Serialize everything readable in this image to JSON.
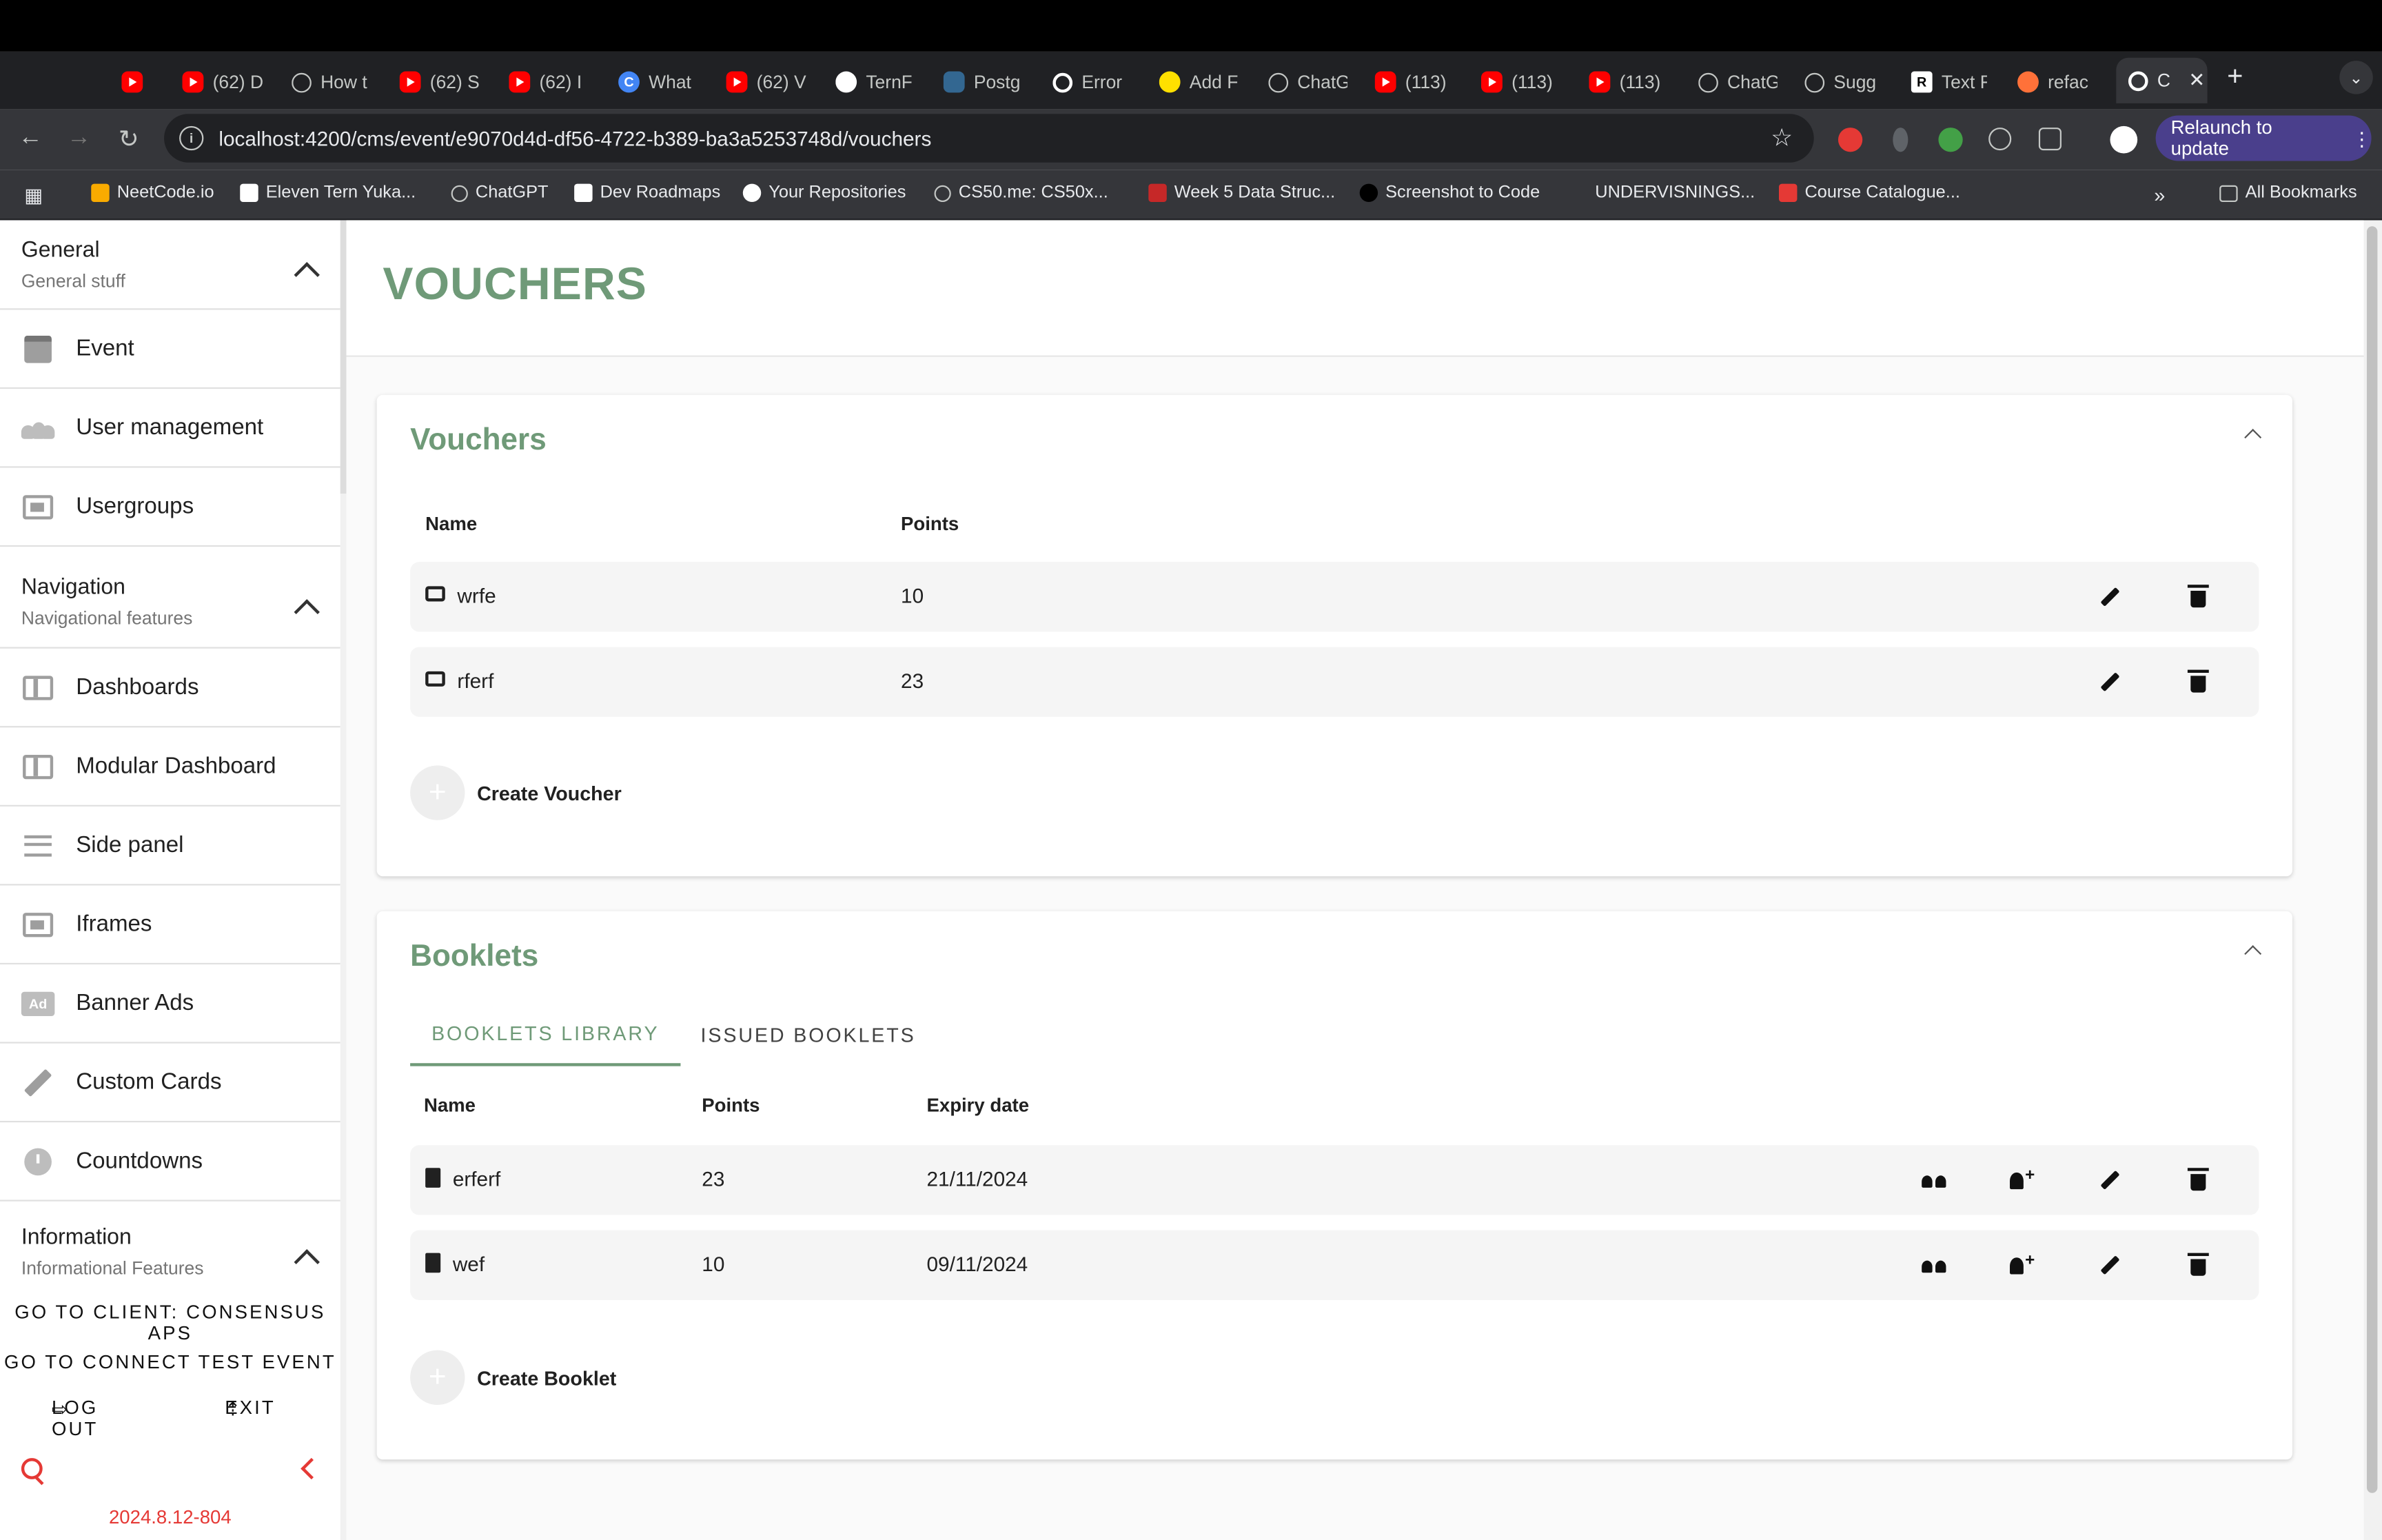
{
  "browser": {
    "tabs": [
      {
        "icon": "youtube-icon",
        "label": ""
      },
      {
        "icon": "youtube-icon",
        "label": "(62) D"
      },
      {
        "icon": "globe-icon",
        "label": "How t"
      },
      {
        "icon": "youtube-icon",
        "label": "(62) S"
      },
      {
        "icon": "youtube-icon",
        "label": "(62) I"
      },
      {
        "icon": "c-icon",
        "label": "What"
      },
      {
        "icon": "youtube-icon",
        "label": "(62) V"
      },
      {
        "icon": "github-icon",
        "label": "TernF"
      },
      {
        "icon": "postgres-icon",
        "label": "Postg"
      },
      {
        "icon": "circle-icon",
        "label": "Error"
      },
      {
        "icon": "add-icon",
        "label": "Add F"
      },
      {
        "icon": "chatgpt-icon",
        "label": "ChatG"
      },
      {
        "icon": "youtube-icon",
        "label": "(113)"
      },
      {
        "icon": "youtube-icon",
        "label": "(113)"
      },
      {
        "icon": "youtube-icon",
        "label": "(113)"
      },
      {
        "icon": "chatgpt-icon",
        "label": "ChatG"
      },
      {
        "icon": "chatgpt-icon",
        "label": "Sugg"
      },
      {
        "icon": "r-icon",
        "label": "Text F"
      },
      {
        "icon": "fox-icon",
        "label": "refac"
      }
    ],
    "active_tab_label": "C",
    "url": "localhost:4200/cms/event/e9070d4d-df56-4722-b389-ba3a5253748d/vouchers",
    "relaunch_label": "Relaunch to update",
    "bookmarks": [
      "NeetCode.io",
      "Eleven Tern Yuka...",
      "ChatGPT",
      "Dev Roadmaps",
      "Your Repositories",
      "CS50.me: CS50x...",
      "Week 5 Data Struc...",
      "Screenshot to Code",
      "UNDERVISNINGS...",
      "Course Catalogue..."
    ],
    "all_bookmarks_label": "All Bookmarks"
  },
  "sidebar": {
    "general": {
      "title": "General",
      "subtitle": "General stuff"
    },
    "general_items": [
      "Event",
      "User management",
      "Usergroups"
    ],
    "navigation": {
      "title": "Navigation",
      "subtitle": "Navigational features"
    },
    "navigation_items": [
      "Dashboards",
      "Modular Dashboard",
      "Side panel",
      "Iframes",
      "Banner Ads",
      "Custom Cards",
      "Countdowns"
    ],
    "information": {
      "title": "Information",
      "subtitle": "Informational Features"
    },
    "goto_client": "GO TO CLIENT: CONSENSUS APS",
    "goto_event": "GO TO CONNECT TEST EVENT",
    "logout": "LOG OUT",
    "exit": "EXIT",
    "version": "2024.8.12-804"
  },
  "page": {
    "title": "VOUCHERS"
  },
  "vouchers": {
    "title": "Vouchers",
    "columns": {
      "name": "Name",
      "points": "Points"
    },
    "rows": [
      {
        "name": "wrfe",
        "points": "10"
      },
      {
        "name": "rferf",
        "points": "23"
      }
    ],
    "create_label": "Create Voucher"
  },
  "booklets": {
    "title": "Booklets",
    "tabs": [
      "BOOKLETS LIBRARY",
      "ISSUED BOOKLETS"
    ],
    "active_tab": "BOOKLETS LIBRARY",
    "columns": {
      "name": "Name",
      "points": "Points",
      "expiry": "Expiry date"
    },
    "rows": [
      {
        "name": "erferf",
        "points": "23",
        "expiry": "21/11/2024"
      },
      {
        "name": "wef",
        "points": "10",
        "expiry": "09/11/2024"
      }
    ],
    "create_label": "Create Booklet"
  },
  "colors": {
    "accent": "#6f9a78",
    "danger": "#e53935",
    "relaunch": "#4a3f8c"
  }
}
